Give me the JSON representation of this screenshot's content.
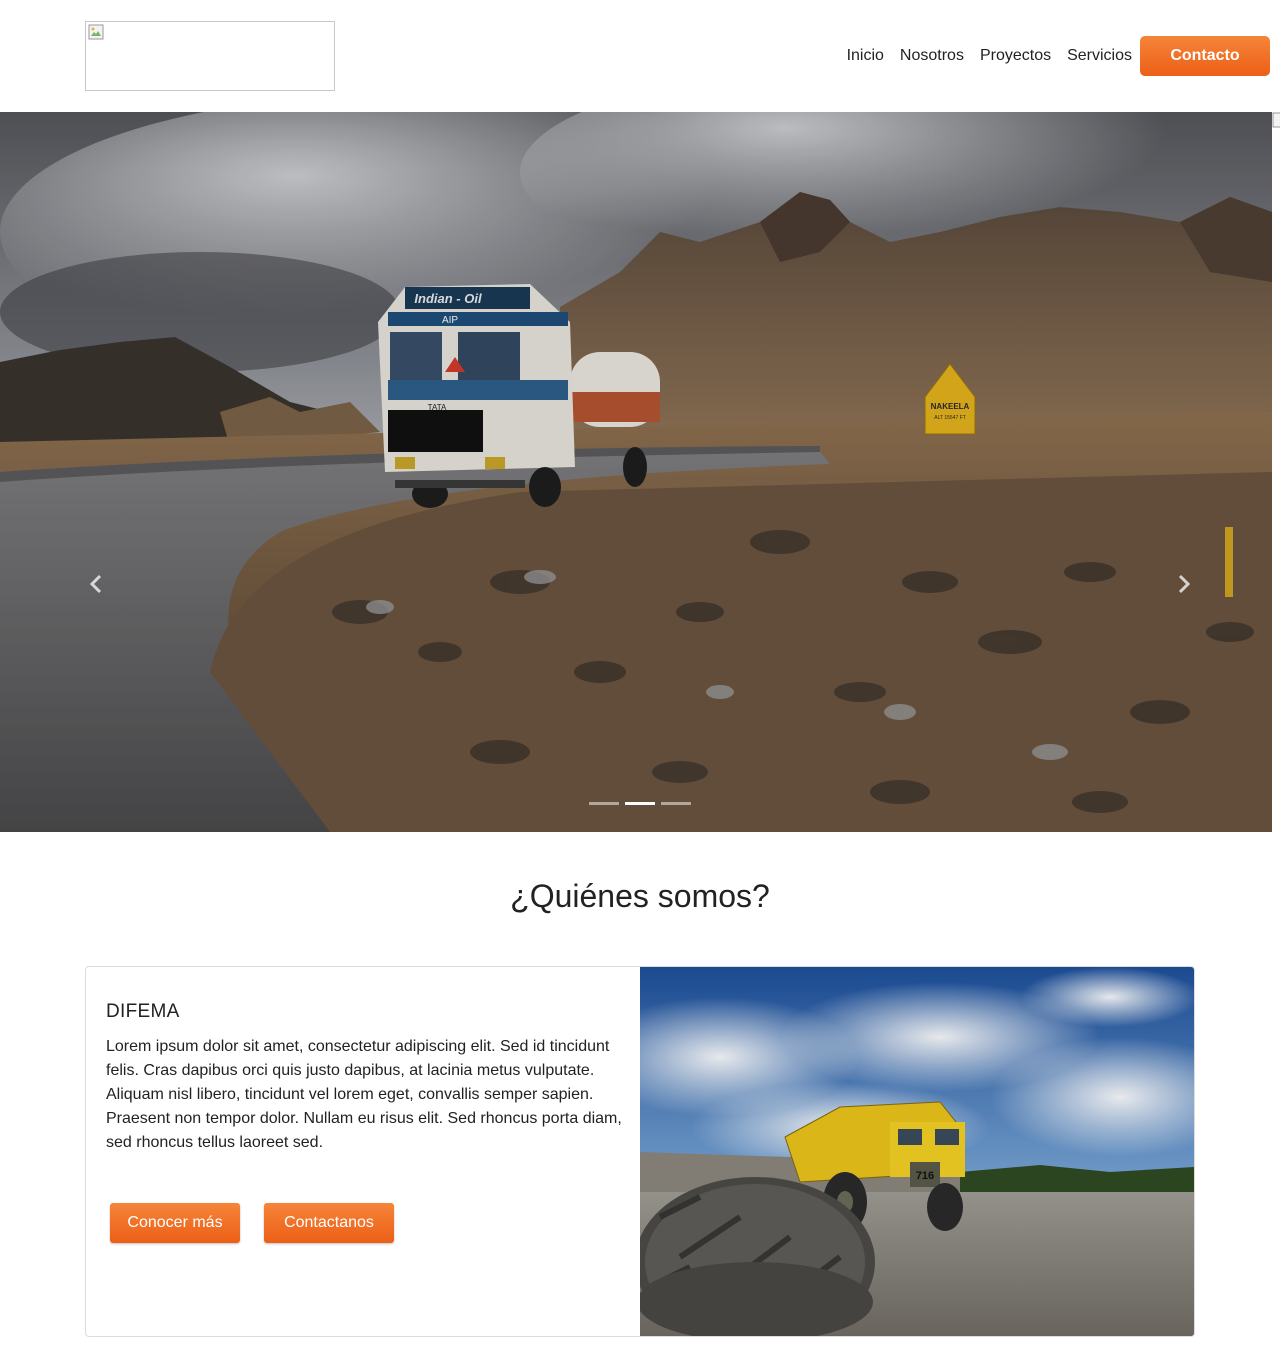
{
  "header": {
    "logo_alt": "",
    "nav": [
      {
        "label": "Inicio"
      },
      {
        "label": "Nosotros"
      },
      {
        "label": "Proyectos"
      },
      {
        "label": "Servicios"
      }
    ],
    "contact_label": "Contacto"
  },
  "hero": {
    "slides_count": 3,
    "active_slide_index": 1,
    "truck_tank_label": "Indian - Oil",
    "truck_plate": "AIP",
    "truck_brand": "TATA",
    "sign_text": "NAKEELA",
    "sign_subtext": "ALT 15547 FT",
    "prev_icon": "chevron-left-icon",
    "next_icon": "chevron-right-icon"
  },
  "about": {
    "section_title": "¿Quiénes somos?",
    "card_title": "DIFEMA",
    "card_text": "Lorem ipsum dolor sit amet, consectetur adipiscing elit. Sed id tincidunt felis. Cras dapibus orci quis justo dapibus, at lacinia metus vulputate. Aliquam nisl libero, tincidunt vel lorem eget, convallis semper sapien. Praesent non tempor dolor. Nullam eu risus elit. Sed rhoncus porta diam, sed rhoncus tellus laoreet sed.",
    "primary_button": "Conocer más",
    "secondary_button": "Contactanos",
    "dump_truck_number": "716"
  },
  "colors": {
    "accent_top": "#f5853a",
    "accent_bottom": "#ec5f16",
    "text": "#222222"
  }
}
